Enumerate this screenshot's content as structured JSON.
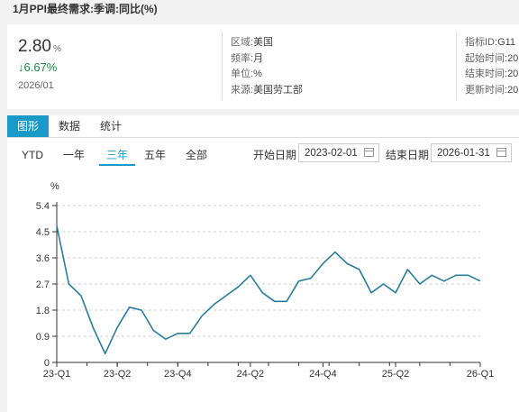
{
  "title": "1月PPI最终需求:季调:同比(%)",
  "summary": {
    "value": "2.80",
    "unit": "%",
    "change": "↓6.67%",
    "date": "2026/01"
  },
  "meta_left": [
    {
      "key": "区域:",
      "value": "美国"
    },
    {
      "key": "频率:",
      "value": "月"
    },
    {
      "key": "单位:",
      "value": "%"
    },
    {
      "key": "来源:",
      "value": "美国劳工部"
    }
  ],
  "meta_right": [
    {
      "key": "指标ID:",
      "value": "G11"
    },
    {
      "key": "起始时间:",
      "value": "20"
    },
    {
      "key": "结束时间:",
      "value": "20"
    },
    {
      "key": "更新时间:",
      "value": "20"
    }
  ],
  "tabs": [
    "图形",
    "数据",
    "统计"
  ],
  "ranges": [
    "YTD",
    "一年",
    "三年",
    "五年",
    "全部"
  ],
  "active_range": "三年",
  "start_label": "开始日期",
  "start_date": "2023-02-01",
  "end_label": "结束日期",
  "end_date": "2026-01-31",
  "colors": {
    "accent": "#1a9bc7",
    "line": "#2a7c9c",
    "down": "#1b8a3c"
  },
  "chart_data": {
    "type": "line",
    "unit_label": "%",
    "ylim": [
      0,
      5.4
    ],
    "yticks": [
      "0",
      "0.9",
      "1.8",
      "2.7",
      "3.6",
      "4.5",
      "5.4"
    ],
    "xtick_labels": [
      "23-Q1",
      "23-Q2",
      "23-Q4",
      "24-Q2",
      "24-Q4",
      "25-Q2",
      "26-Q1"
    ],
    "xtick_index": [
      0,
      5,
      10,
      16,
      22,
      28,
      35
    ],
    "series": [
      {
        "values": [
          4.7,
          2.7,
          2.3,
          1.2,
          0.3,
          1.2,
          1.9,
          1.8,
          1.1,
          0.8,
          1.0,
          1.0,
          1.6,
          2.0,
          2.3,
          2.6,
          3.0,
          2.4,
          2.1,
          2.1,
          2.8,
          2.9,
          3.4,
          3.8,
          3.4,
          3.2,
          2.4,
          2.7,
          2.4,
          3.2,
          2.7,
          3.0,
          2.8,
          3.0,
          3.0,
          2.8
        ]
      }
    ],
    "grid": "horizontal-dashed",
    "legend": "none"
  }
}
